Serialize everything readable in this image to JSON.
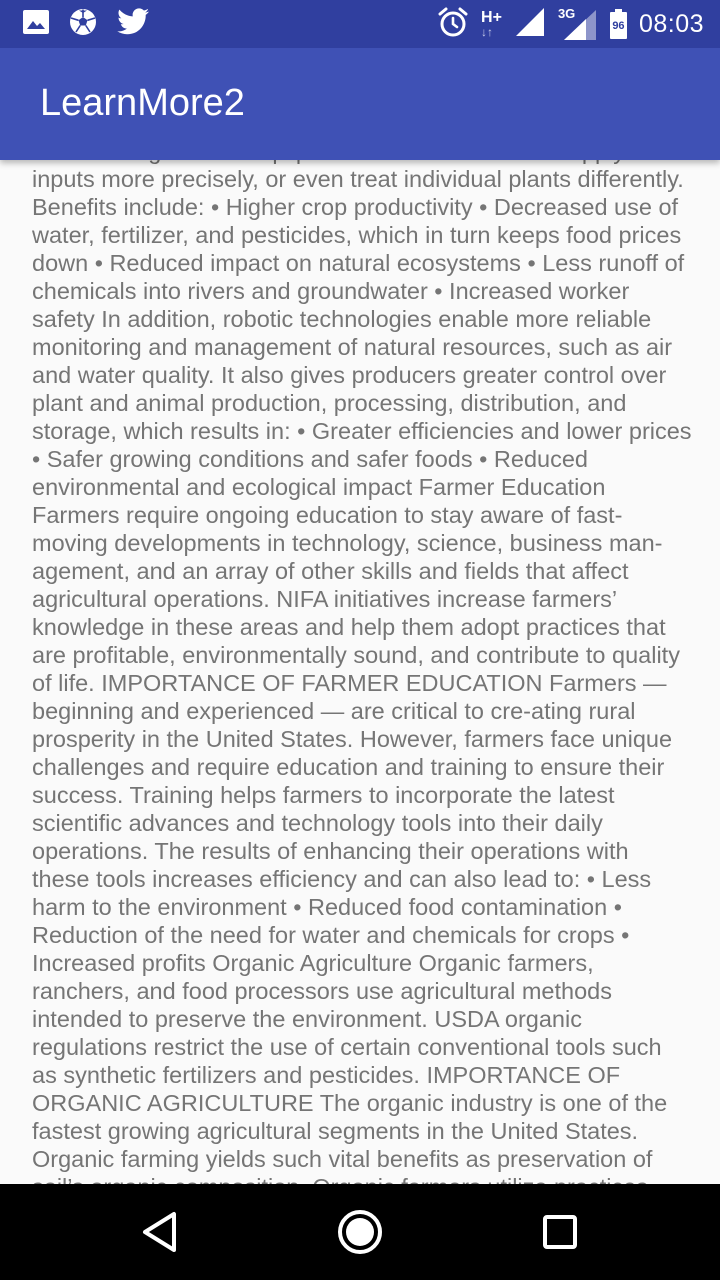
{
  "status_bar": {
    "left_icons": [
      "image-icon",
      "soccer-ball-icon",
      "twitter-icon"
    ],
    "right_icons": [
      "alarm-icon",
      "signal-icon",
      "signal-3g-icon",
      "battery-icon"
    ],
    "network_type": "H+",
    "network_type_2": "3G",
    "battery_level": "96",
    "time": "08:03"
  },
  "app_bar": {
    "title": "LearnMore2"
  },
  "content": {
    "text": "Precision agriculture equipment enables farmers to apply inputs more precisely, or even treat individual plants differently. Benefits include: • Higher crop productivity • Decreased  use of water, fertilizer, and pesticides, which in turn keeps food prices down • Reduced impact on natural ecosystems • Less runoff of chemicals into rivers and groundwater • Increased worker safety In addition, robotic technologies enable more reliable monitoring and management of natural resources, such as air and water quality. It also gives producers greater control over plant and animal production, processing, distribution, and storage, which results in: • Greater efficiencies and lower prices • Safer growing conditions and safer foods • Reduced environmental and ecological impact Farmer Education Farmers require ongoing education to stay aware of fast-moving developments in technology, science, business man-agement, and an array of other skills and fields that affect agricultural operations. NIFA initiatives increase farmers’ knowledge in these areas and help them adopt practices that are profitable, environmentally sound, and contribute to quality of life. IMPORTANCE OF FARMER EDUCATION Farmers — beginning and experienced — are critical to cre-ating rural prosperity in the United States. However, farmers face unique challenges and require education and training to ensure their success. Training helps farmers to incorporate the latest scientific advances and technology tools into their daily operations. The results of enhancing their operations with these tools increases efficiency and can also lead to: • Less harm to the environment • Reduced food contamination • Reduction of the need for water and chemicals for crops • Increased profits Organic Agriculture Organic farmers, ranchers, and food processors use agricultural methods intended to preserve the environment. USDA organic regulations restrict the use of certain conventional tools such as synthetic fertilizers and pesticides. IMPORTANCE OF ORGANIC AGRICULTURE The organic industry is one of the fastest growing agricultural segments in the United States. Organic farming yields such vital benefits as preservation of soil’s organic composition. Organic farmers utilize practices"
  },
  "nav_bar": {
    "buttons": [
      "back-icon",
      "home-icon",
      "recents-icon"
    ]
  },
  "colors": {
    "status_bar": "#303f9f",
    "app_bar": "#3f51b5",
    "background": "#fafafa",
    "body_text": "#757575",
    "nav_bar": "#000000"
  }
}
